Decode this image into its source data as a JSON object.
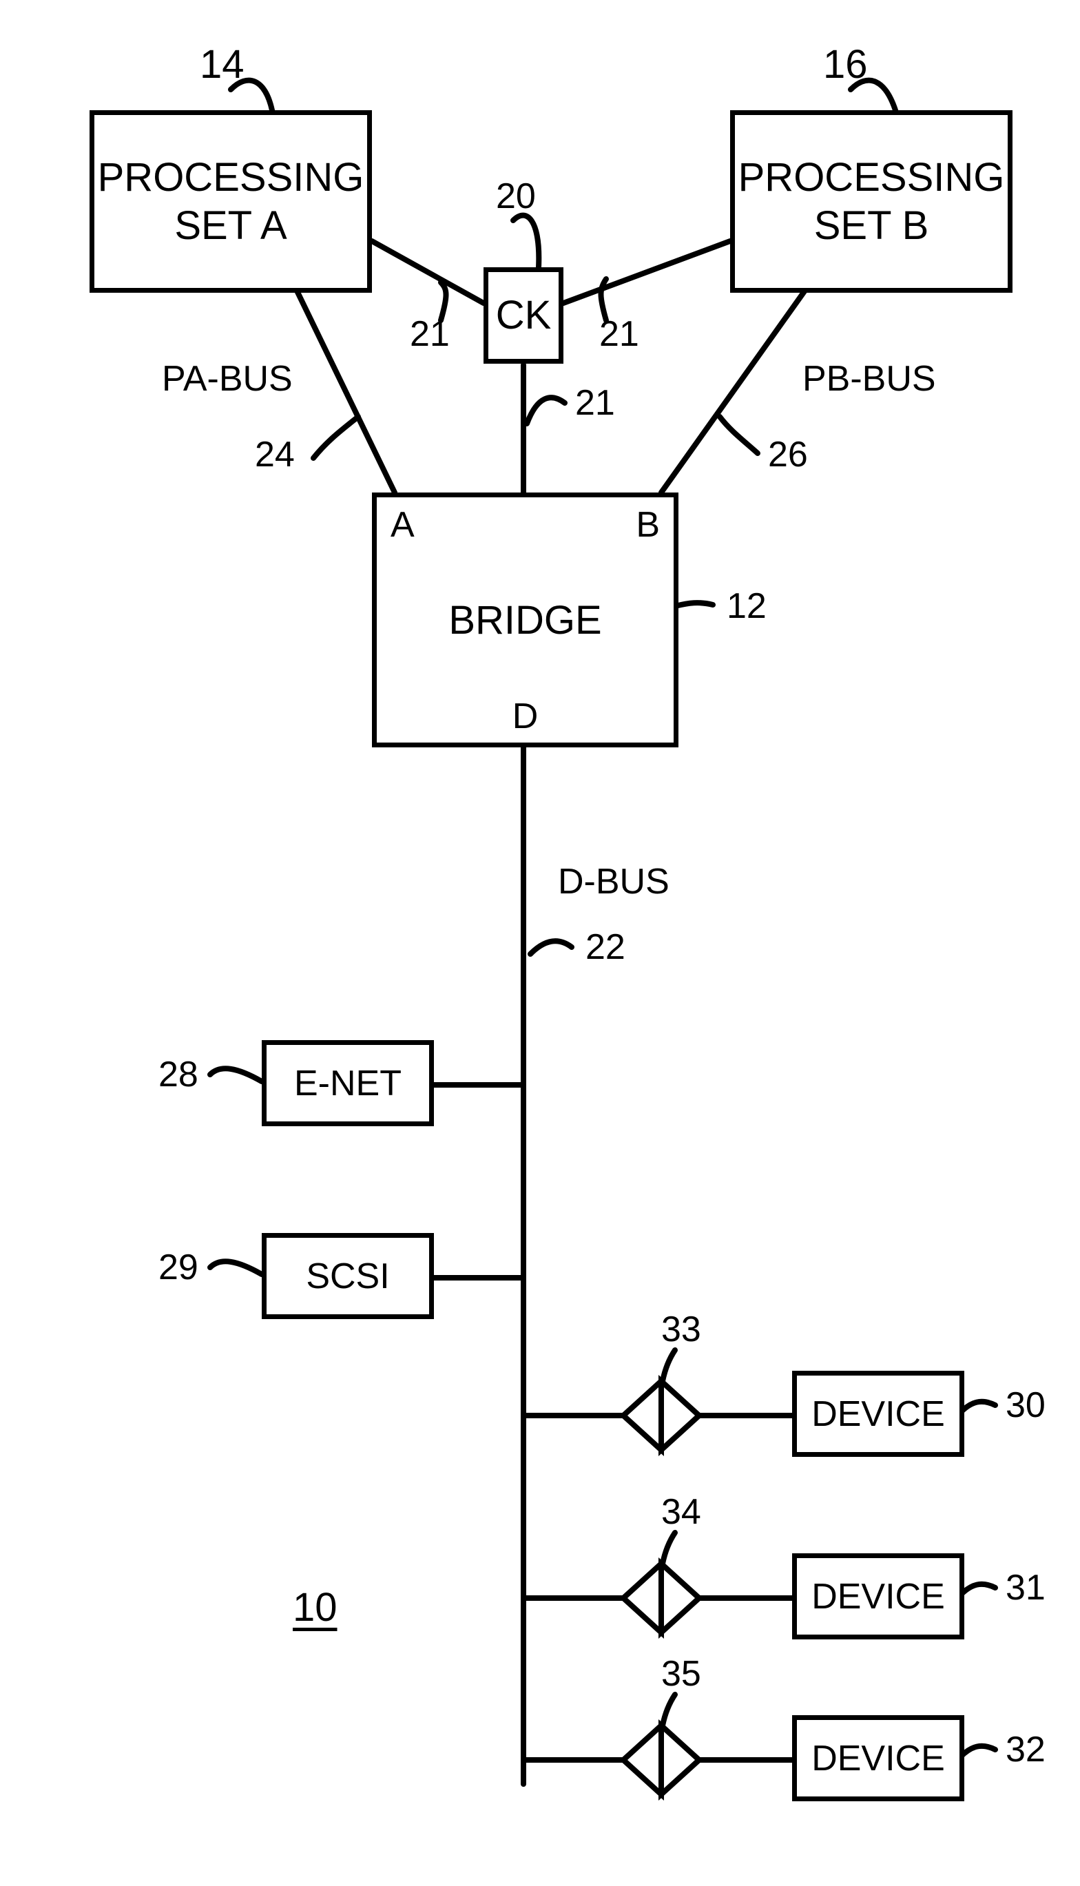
{
  "blocks": {
    "procA": {
      "line1": "PROCESSING",
      "line2": "SET A"
    },
    "procB": {
      "line1": "PROCESSING",
      "line2": "SET B"
    },
    "ck": "CK",
    "bridge": "BRIDGE",
    "bridgeA": "A",
    "bridgeB": "B",
    "bridgeD": "D",
    "enet": "E-NET",
    "scsi": "SCSI",
    "dev1": "DEVICE",
    "dev2": "DEVICE",
    "dev3": "DEVICE"
  },
  "refs": {
    "r14": "14",
    "r16": "16",
    "r20": "20",
    "r21a": "21",
    "r21b": "21",
    "r21c": "21",
    "paBus": "PA-BUS",
    "pbBus": "PB-BUS",
    "r24": "24",
    "r26": "26",
    "r12": "12",
    "dBus": "D-BUS",
    "r22": "22",
    "r28": "28",
    "r29": "29",
    "r33": "33",
    "r34": "34",
    "r35": "35",
    "r30": "30",
    "r31": "31",
    "r32": "32",
    "r10": "10"
  }
}
